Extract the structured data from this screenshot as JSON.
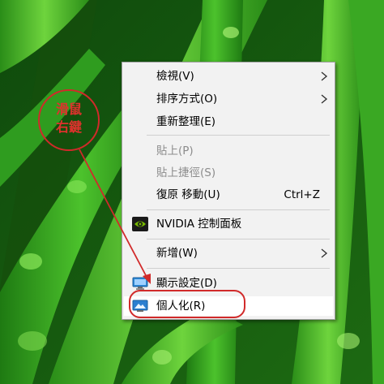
{
  "annotation": {
    "line1": "滑鼠",
    "line2": "右鍵",
    "color": "#d12a2a"
  },
  "menu": {
    "items": [
      {
        "label": "檢視(V)",
        "enabled": true,
        "submenu": true
      },
      {
        "label": "排序方式(O)",
        "enabled": true,
        "submenu": true
      },
      {
        "label": "重新整理(E)",
        "enabled": true
      },
      {
        "label": "貼上(P)",
        "enabled": false
      },
      {
        "label": "貼上捷徑(S)",
        "enabled": false
      },
      {
        "label": "復原 移動(U)",
        "enabled": true,
        "shortcut": "Ctrl+Z"
      },
      {
        "label": "NVIDIA 控制面板",
        "enabled": true,
        "icon": "nvidia-icon"
      },
      {
        "label": "新增(W)",
        "enabled": true,
        "submenu": true
      },
      {
        "label": "顯示設定(D)",
        "enabled": true,
        "icon": "display-settings-icon"
      },
      {
        "label": "個人化(R)",
        "enabled": true,
        "icon": "personalize-icon",
        "highlighted": true
      }
    ]
  },
  "colors": {
    "menu_bg": "#f2f2f2",
    "disabled_text": "#8c8c8c",
    "highlight": "#ffffff",
    "leaf_green": "#2f9c1f"
  }
}
